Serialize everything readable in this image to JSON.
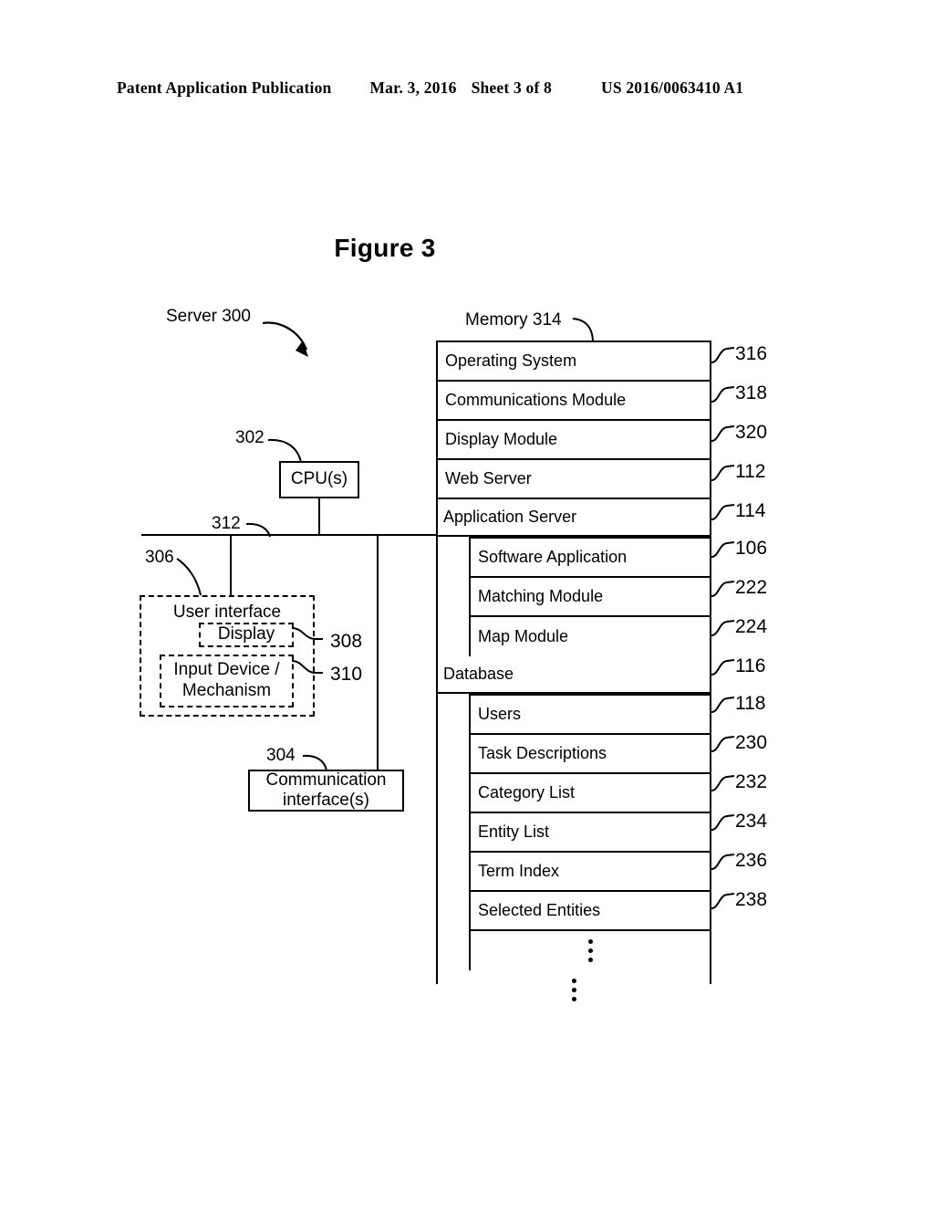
{
  "header": {
    "left": "Patent Application Publication",
    "date": "Mar. 3, 2016",
    "sheet": "Sheet 3 of 8",
    "publication_number": "US 2016/0063410 A1"
  },
  "figure": {
    "title": "Figure 3"
  },
  "labels": {
    "server": "Server 300",
    "memory": "Memory 314",
    "cpu_ref": "302",
    "bus_ref": "312",
    "ui_ref": "306",
    "display_ref": "308",
    "input_ref": "310",
    "comm_ref": "304"
  },
  "boxes": {
    "cpu": "CPU(s)",
    "user_interface": "User interface",
    "display": "Display",
    "input_device": "Input Device /\nMechanism",
    "input_device_line1": "Input Device /",
    "input_device_line2": "Mechanism",
    "communication_interface_line1": "Communication",
    "communication_interface_line2": "interface(s)"
  },
  "memory_rows": [
    {
      "label": "Operating System",
      "ref": "316",
      "level": 0
    },
    {
      "label": "Communications Module",
      "ref": "318",
      "level": 0
    },
    {
      "label": "Display Module",
      "ref": "320",
      "level": 0
    },
    {
      "label": "Web Server",
      "ref": "112",
      "level": 0
    },
    {
      "label": "Application Server",
      "ref": "114",
      "level": 0
    },
    {
      "label": "Software Application",
      "ref": "106",
      "level": 1
    },
    {
      "label": "Matching Module",
      "ref": "222",
      "level": 1
    },
    {
      "label": "Map Module",
      "ref": "224",
      "level": 1
    },
    {
      "label": "Database",
      "ref": "116",
      "level": 0
    },
    {
      "label": "Users",
      "ref": "118",
      "level": 1
    },
    {
      "label": "Task Descriptions",
      "ref": "230",
      "level": 1
    },
    {
      "label": "Category List",
      "ref": "232",
      "level": 1
    },
    {
      "label": "Entity List",
      "ref": "234",
      "level": 1
    },
    {
      "label": "Term Index",
      "ref": "236",
      "level": 1
    },
    {
      "label": "Selected Entities",
      "ref": "238",
      "level": 1
    },
    {
      "label": "",
      "ref": "",
      "level": 1,
      "ellipsis": true
    },
    {
      "label": "",
      "ref": "",
      "level": 0,
      "ellipsis": true
    }
  ],
  "colors": {
    "stroke": "#000000",
    "background": "#ffffff"
  }
}
